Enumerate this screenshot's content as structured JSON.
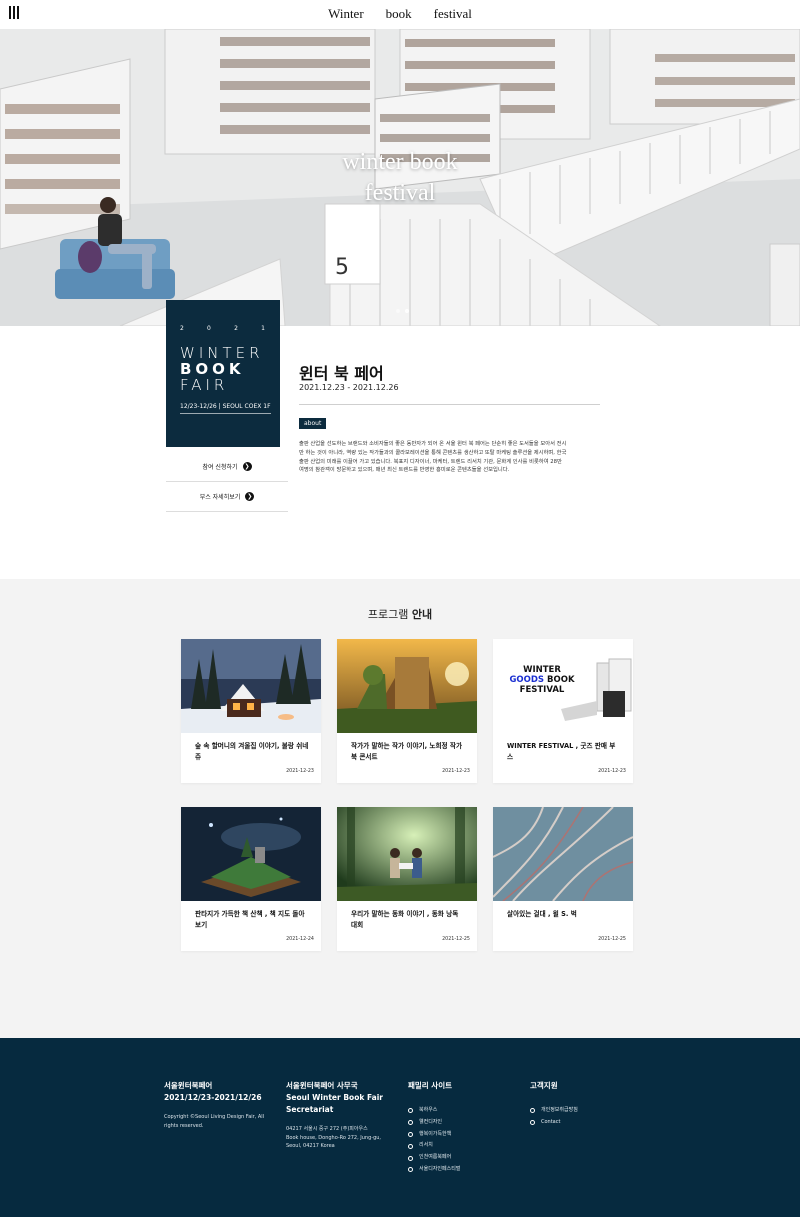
{
  "nav": {
    "links": [
      "Winter",
      "book",
      "festival"
    ]
  },
  "hero": {
    "title_line1": "winter book",
    "title_line2": "festival",
    "slide_count": 2,
    "active_slide": 1
  },
  "poster": {
    "year_digits": [
      "2",
      "0",
      "2",
      "1"
    ],
    "line1": "WINTER",
    "line2": "BOOK",
    "line3": "FAIR",
    "subtitle": "12/23-12/26 | SEOUL COEX 1F"
  },
  "side_buttons": {
    "apply": "참여 신청하기",
    "booth": "부스 자세히보기"
  },
  "event": {
    "title": "윈터 북 페어",
    "date": "2021.12.23 - 2021.12.26",
    "badge": "about",
    "description": "출판 산업을 선도하는 브랜드와 소비자들의 좋은 동반자가 되어 온 서울 윈터 북 페어는 단순히 좋은 도서들을 모아서 전시만 하는 것이 아니라, 역량 있는 작가들과의 콜라보레이션을 통해 콘텐츠를 생산하고 또탈 마케팅 솔루션을 제시하며, 한국 출판 산업의 미래를 이끌어 가고 있습니다. 북표지 디자이너, 마케터, 트렌드 리서치 기관, 문화계 인사를 비롯하여 28만 여명의 참관객이 방문하고 있으며, 매년 최신 트렌드를 반영한 흥미로운 콘텐츠들을 선보입니다."
  },
  "program": {
    "title_normal": "프로그램 ",
    "title_bold": "안내",
    "cards": [
      {
        "title": "숲 속 할머니의 겨울집 이야기, 불랑 쉬네쥬",
        "date": "2021-12-23"
      },
      {
        "title": "작가가 말하는 작가 이야기, 노희정 작가 북 콘서트",
        "date": "2021-12-23"
      },
      {
        "title": "WINTER FESTIVAL , 굿즈 판매 부스",
        "date": "2021-12-23"
      },
      {
        "title": "판타지가 가득한 책 산책 , 책 지도 돌아보기",
        "date": "2021-12-24"
      },
      {
        "title": "우리가 말하는 동화 이야기 , 동화 낭독 대회",
        "date": "2021-12-25"
      },
      {
        "title": "살아있는 걸대 , 윌 S. 벅",
        "date": "2021-12-25"
      }
    ],
    "goods_image_text": {
      "line1": "WINTER",
      "line2a": "GOODS",
      "line2b": " BOOK",
      "line3": "FESTIVAL"
    }
  },
  "footer": {
    "col1": {
      "title": "서울윈터북페어",
      "dates": "2021/12/23-2021/12/26",
      "copyright": "Copyright ©Seoul Living Design Fair, All rights reserved."
    },
    "col2": {
      "title": "서울윈터북페어 사무국",
      "title_en": "Seoul Winter Book Fair Secretariat",
      "address_kr": "04217 서울시 중구 272 (주)피아우스",
      "address_en": "Book house, Dongho-Ro 272, Jung-gu, Seoul, 04217 Korea"
    },
    "col3": {
      "title": "패밀리 사이트",
      "links": [
        "북하우스",
        "웰컨디자인",
        "행복이가득한책",
        "리서치",
        "인천여름북페어",
        "서울디자인페스티벌"
      ]
    },
    "col4": {
      "title": "고객지원",
      "links": [
        "개인정보취급방침",
        "Contact"
      ]
    }
  },
  "colors": {
    "navy": "#0c2b3e",
    "footer_bg": "#062a3f",
    "program_bg": "#f3f3f3",
    "goods_blue": "#1a2fd1"
  }
}
